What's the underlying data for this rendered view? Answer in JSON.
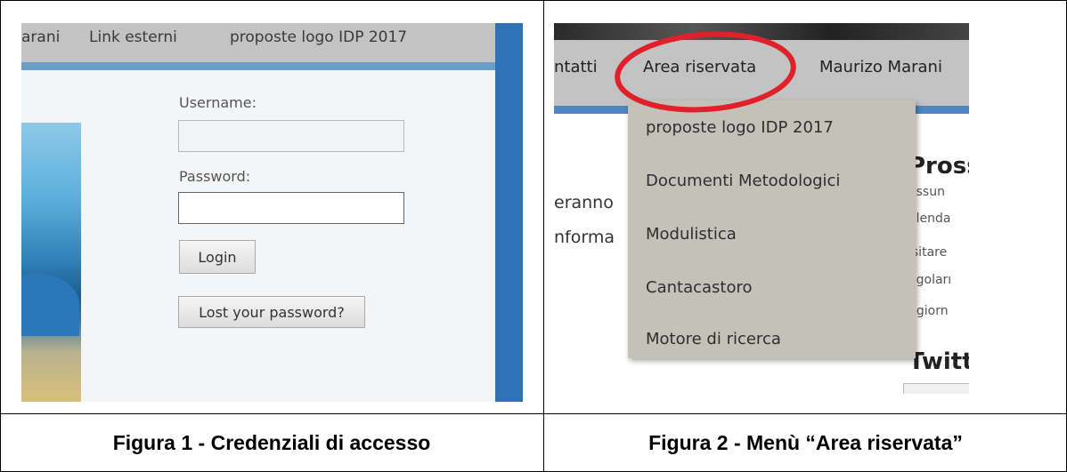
{
  "figure1": {
    "nav": {
      "item1": "arani",
      "item2": "Link esterni",
      "item3": "proposte logo IDP 2017"
    },
    "login": {
      "username_label": "Username:",
      "username_value": "",
      "password_label": "Password:",
      "password_value": "",
      "login_button": "Login",
      "lost_password_button": "Lost your password?"
    },
    "caption": "Figura 1 - Credenziali di accesso"
  },
  "figure2": {
    "nav": {
      "item1": "ntatti",
      "item2": "Area riservata",
      "item3": "Maurizo Marani"
    },
    "dropdown": [
      "proposte logo IDP 2017",
      "Documenti Metodologici",
      "Modulistica",
      "Cantacastoro",
      "Motore di ricerca"
    ],
    "content": {
      "line1": "eranno",
      "line2": "nforma",
      "heading1": "Pross",
      "side": [
        "essun",
        "alenda",
        "isitare",
        "egoları",
        "ggiorn"
      ],
      "heading2": "Twitt"
    },
    "highlight_color": "#e0202a",
    "caption": "Figura 2 - Menù “Area riservata”"
  }
}
